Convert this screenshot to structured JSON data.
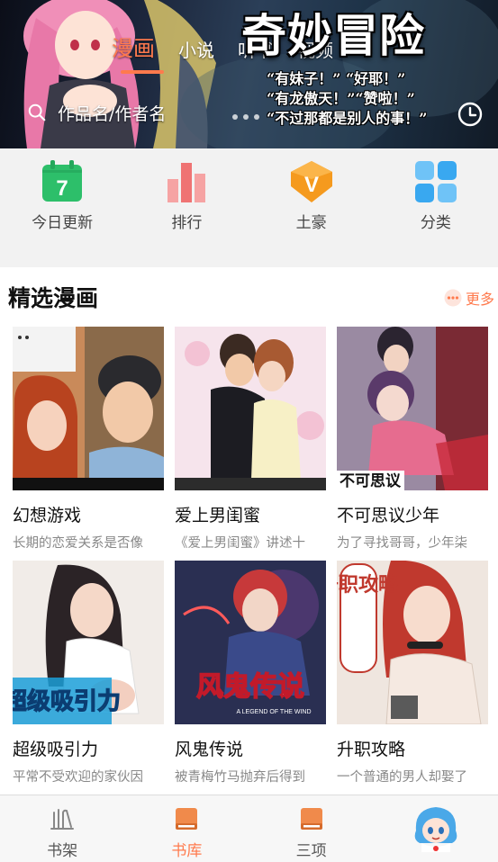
{
  "banner": {
    "tabs": [
      {
        "label": "漫画",
        "active": true
      },
      {
        "label": "小说",
        "active": false
      },
      {
        "label": "听书",
        "active": false
      },
      {
        "label": "视频",
        "active": false
      }
    ],
    "search_placeholder": "作品名/作者名",
    "promo_title": "奇妙冒险",
    "promo_lines": [
      "“有妹子！”  “好耶！”",
      "“有龙傲天！”“赞啦！”",
      "“不过那都是别人的事！”"
    ],
    "accent_color": "#ff7a4d"
  },
  "categories": [
    {
      "label": "今日更新",
      "icon": "calendar-icon",
      "icon_text": "7",
      "color": "#2dbf6a"
    },
    {
      "label": "排行",
      "icon": "ranking-bars-icon",
      "color": "#f27e7e"
    },
    {
      "label": "土豪",
      "icon": "vip-diamond-icon",
      "icon_text": "V",
      "color": "#f59a1e"
    },
    {
      "label": "分类",
      "icon": "grid-icon",
      "color": "#39a8f0"
    }
  ],
  "section": {
    "title": "精选漫画",
    "more_label": "更多"
  },
  "comics": [
    {
      "title": "幻想游戏",
      "desc": "长期的恋爱关系是否像"
    },
    {
      "title": "爱上男闺蜜",
      "desc": "《爱上男闺蜜》讲述十"
    },
    {
      "title": "不可思议少年",
      "desc": "为了寻找哥哥，少年柒"
    },
    {
      "title": "超级吸引力",
      "desc": "平常不受欢迎的家伙因"
    },
    {
      "title": "风鬼传说",
      "desc": "被青梅竹马抛弃后得到"
    },
    {
      "title": "升职攻略",
      "desc": "一个普通的男人却娶了"
    }
  ],
  "cover_lettering": {
    "c3": "不可思议",
    "c4": "超级吸引力",
    "c5": "风鬼传说",
    "c5_sub": "A LEGEND OF THE WIND",
    "c6": "升职攻略"
  },
  "bottom_nav": [
    {
      "label": "书架",
      "icon": "bookshelf-icon",
      "active": false
    },
    {
      "label": "书库",
      "icon": "book-icon",
      "active": true
    },
    {
      "label": "三项",
      "icon": "book-icon",
      "active": false
    }
  ]
}
